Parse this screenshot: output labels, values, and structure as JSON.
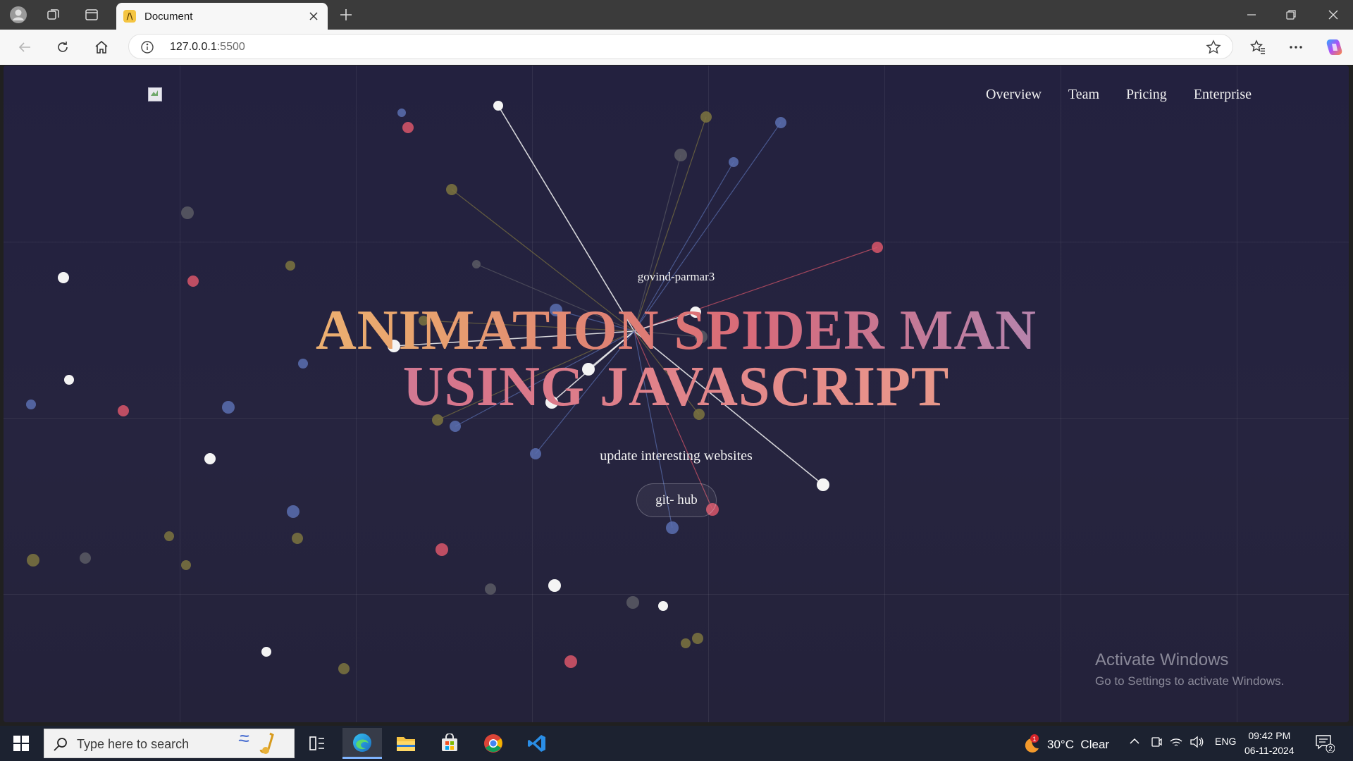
{
  "browser": {
    "tab_title": "Document",
    "url_host": "127.0.0.1",
    "url_port": ":5500"
  },
  "page": {
    "nav": [
      "Overview",
      "Team",
      "Pricing",
      "Enterprise"
    ],
    "credit": "govind-parmar3",
    "headline_line1": "ANIMATION SPIDER MAN",
    "headline_line2": "USING JAVASCRIPT",
    "tagline": "update interesting websites",
    "button": "git- hub",
    "colors": {
      "background": "#242240",
      "dot_white": "#f4f4f4",
      "dot_blue": "#5a6fb0",
      "dot_red": "#d9566a",
      "dot_olive": "#7d7440",
      "dot_gray": "#5a5a64"
    }
  },
  "watermark": {
    "line1": "Activate Windows",
    "line2": "Go to Settings to activate Windows."
  },
  "taskbar": {
    "search_placeholder": "Type here to search",
    "weather": "30°C  Clear",
    "weather_badge": "1",
    "lang": "ENG",
    "time": "09:42 PM",
    "date": "06-11-2024",
    "notification_count": "2"
  }
}
